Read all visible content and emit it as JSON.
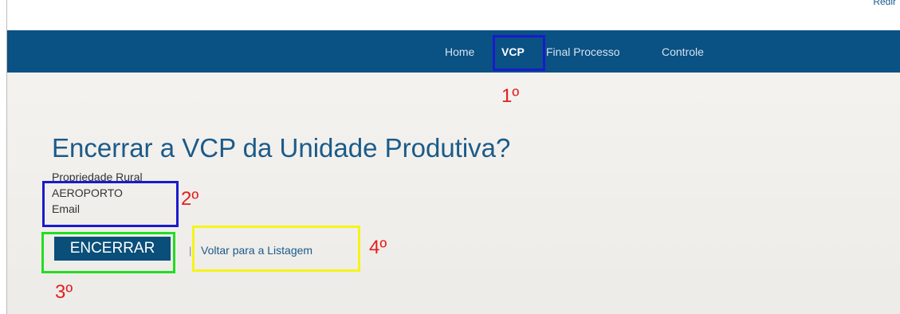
{
  "top_corner_text": "Redir",
  "nav": {
    "items": [
      {
        "label": "Home",
        "active": false
      },
      {
        "label": "VCP",
        "active": true
      },
      {
        "label": "Final Processo",
        "active": false
      },
      {
        "label": "Controle",
        "active": false
      }
    ]
  },
  "page": {
    "title": "Encerrar a VCP da Unidade Produtiva?",
    "property_label": "Propriedade Rural",
    "property_value": "AEROPORTO",
    "email_label": "Email",
    "submit_label": "ENCERRAR",
    "separator": "|",
    "back_link": "Voltar para a Listagem"
  },
  "annotations": {
    "step1": "1º",
    "step2": "2º",
    "step3": "3º",
    "step4": "4º"
  },
  "colors": {
    "navbar": "#0a5184",
    "accent": "#1b5b8a",
    "button": "#0a4e7a",
    "annotation_text": "#e02020",
    "box_blue": "#1a1acd",
    "box_green": "#22dd22",
    "box_yellow": "#f4f41a"
  }
}
